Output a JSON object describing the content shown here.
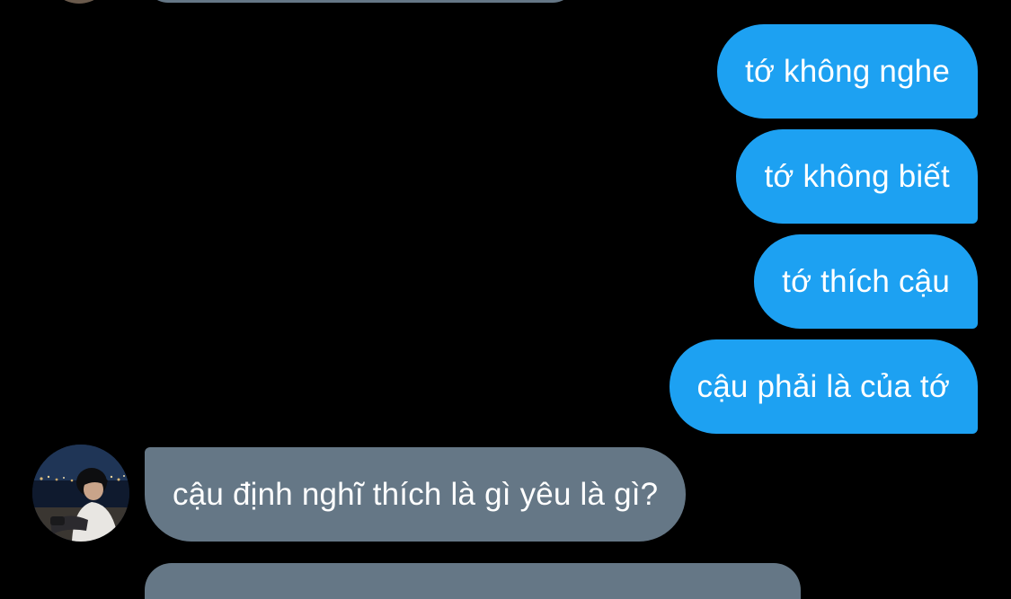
{
  "conversation": {
    "messages": [
      {
        "direction": "outgoing",
        "text": "tớ không nghe"
      },
      {
        "direction": "outgoing",
        "text": "tớ không biết"
      },
      {
        "direction": "outgoing",
        "text": "tớ thích cậu"
      },
      {
        "direction": "outgoing",
        "text": "cậu phải là của tớ"
      },
      {
        "direction": "incoming",
        "text": "cậu định nghĩ thích là gì yêu là gì?"
      }
    ],
    "incoming_avatar_icon": "user-avatar-photo"
  },
  "colors": {
    "background": "#000000",
    "outgoing_bubble": "#1da1f2",
    "incoming_bubble": "#657786",
    "text": "#ffffff"
  }
}
